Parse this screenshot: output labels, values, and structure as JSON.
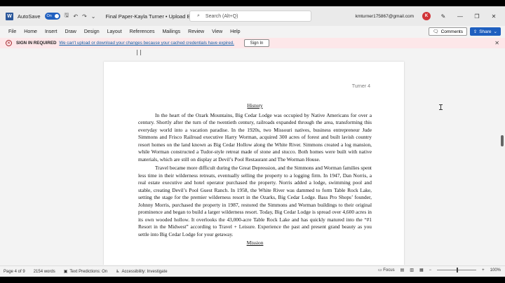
{
  "titlebar": {
    "autosave_label": "AutoSave",
    "autosave_state": "On",
    "document_title": "Final Paper-Kayla Turner • Upload Blocked ⌄",
    "search_placeholder": "Search (Alt+Q)",
    "user_email": "kmturner175867@gmail.com",
    "avatar_initial": "K"
  },
  "menu": {
    "items": [
      "File",
      "Home",
      "Insert",
      "Draw",
      "Design",
      "Layout",
      "References",
      "Mailings",
      "Review",
      "View",
      "Help"
    ],
    "comments_label": "Comments",
    "share_label": "Share"
  },
  "warning": {
    "title": "SIGN IN REQUIRED",
    "message": "We can't upload or download your changes because your cached credentials have expired.",
    "signin_label": "Sign In"
  },
  "document": {
    "header": "Turner 4",
    "heading1": "History",
    "para1": "In the heart of the Ozark Mountains, Big Cedar Lodge was occupied by Native Americans for over a century. Shortly after the turn of the twentieth century, railroads expanded through the area, transforming this everyday world into a vacation paradise. In the 1920s, two Missouri natives, business entrepreneur Jude Simmons and Frisco Railroad executive Harry Worman, acquired 300 acres of forest and built lavish country resort homes on the land known as Big Cedar Hollow along the White River. Simmons created a log mansion, while Worman constructed a Tudor-style retreat made of stone and stucco. Both homes were built with native materials, which are still on display at Devil’s Pool Restaurant and The Worman House.",
    "para2": "Travel became more difficult during the Great Depression, and the Simmons and Worman families spent less time in their wilderness retreats, eventually selling the property to a logging firm. In 1947, Dan Norris, a real estate executive and hotel operator purchased the property. Norris added a lodge, swimming pool and stable, creating Devil’s Pool Guest Ranch. In 1958, the White River was dammed to form Table Rock Lake, setting the stage for the premier wilderness resort in the Ozarks, Big Cedar Lodge. Bass Pro Shops’ founder, Johnny Morris, purchased the property in 1987, restored the Simmons and Worman buildings to their original prominence and began to build a larger wilderness resort. Today, Big Cedar Lodge is spread over 4,600 acres in its own wooded hollow. It overlooks the 43,000-acre Table Rock Lake and has quickly matured into the “#1 Resort in the Midwest” according to Travel + Leisure. Experience the past and present grand beauty as you settle into Big Cedar Lodge for your getaway.",
    "heading2": "Mission"
  },
  "status": {
    "page": "Page 4 of 9",
    "words": "2154 words",
    "text_predictions": "Text Predictions: On",
    "accessibility": "Accessibility: Investigate",
    "focus": "Focus",
    "zoom": "100%",
    "zoom_level": 0.5
  },
  "colors": {
    "accent": "#1f5fbf",
    "warning_bg": "#fde7e9",
    "warning_icon": "#a4262c",
    "link": "#0f5ea8"
  }
}
